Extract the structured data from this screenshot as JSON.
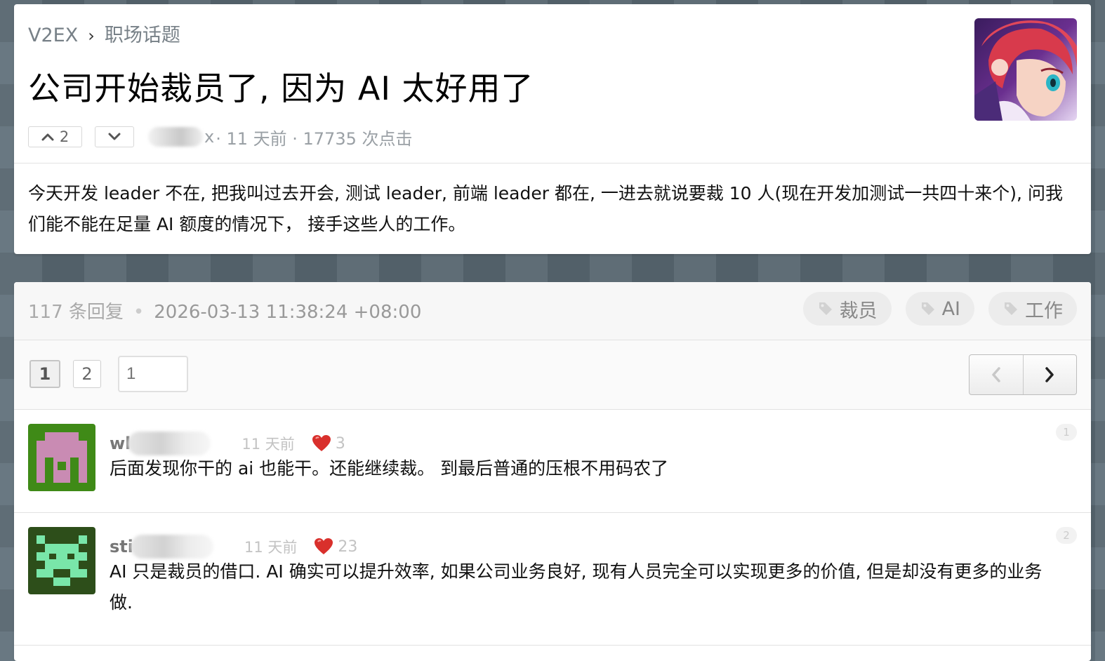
{
  "breadcrumb": {
    "site": "V2EX",
    "separator": "›",
    "node": "职场话题"
  },
  "topic": {
    "title": "公司开始裁员了, 因为 AI 太好用了",
    "upvotes": "2",
    "author_suffix": "x",
    "meta": " · 11 天前 · 17735 次点击",
    "content": "今天开发 leader 不在, 把我叫过去开会, 测试 leader, 前端 leader 都在, 一进去就说要裁 10 人(现在开发加测试一共四十来个), 问我们能不能在足量 AI 额度的情况下， 接手这些人的工作。"
  },
  "replies_header": {
    "count": "117 条回复",
    "dot": "•",
    "timestamp": "2026-03-13 11:38:24 +08:00",
    "tags": [
      "裁员",
      "AI",
      "工作"
    ]
  },
  "pagination": {
    "pages": [
      "1",
      "2"
    ],
    "current": "1",
    "input_placeholder": "1"
  },
  "replies": [
    {
      "user_prefix": "wl",
      "time": "11 天前",
      "likes": "3",
      "floor": "1",
      "content": "后面发现你干的 ai 也能干。还能继续裁。 到最后普通的压根不用码农了"
    },
    {
      "user_prefix": "sti",
      "time": "11 天前",
      "likes": "23",
      "floor": "2",
      "content": "AI 只是裁员的借口. AI 确实可以提升效率, 如果公司业务良好, 现有人员完全可以实现更多的价值, 但是却没有更多的业务做."
    }
  ],
  "icons": {
    "upvote": "chevron-up-icon",
    "downvote": "chevron-down-icon",
    "tag": "tag-icon",
    "heart": "heart-icon",
    "prev": "chevron-left-icon",
    "next": "chevron-right-icon"
  },
  "colors": {
    "background": "#5b6b76",
    "heart": "#d9302c",
    "avatar1_bg": "#3f8a17",
    "avatar1_fg": "#c98bb3",
    "avatar2_bg": "#2d4e1a",
    "avatar2_fg": "#79e6a9"
  }
}
